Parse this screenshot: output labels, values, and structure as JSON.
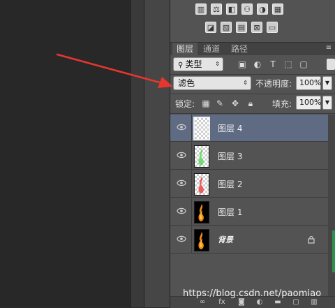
{
  "tabs": [
    "图层",
    "通道",
    "路径"
  ],
  "filter": {
    "label": "类型"
  },
  "blend_mode": {
    "value": "滤色"
  },
  "opacity": {
    "label": "不透明度:",
    "value": "100%"
  },
  "lock": {
    "label": "锁定:"
  },
  "fill": {
    "label": "填充:",
    "value": "100%"
  },
  "layers": [
    {
      "name": "图层 4",
      "selected": true
    },
    {
      "name": "图层 3"
    },
    {
      "name": "图层 2"
    },
    {
      "name": "图层 1"
    },
    {
      "name": "背景",
      "locked": true
    }
  ],
  "watermark": "https://blog.csdn.net/paomiao",
  "colors": {
    "panel": "#535353",
    "selection": "#5e6b82",
    "arrow": "#e8362f"
  }
}
